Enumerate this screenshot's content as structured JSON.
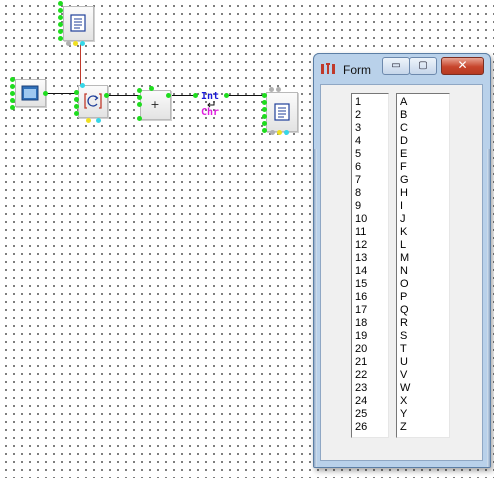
{
  "window": {
    "title": "Form",
    "minimize_label": "▭",
    "maximize_label": "▢",
    "close_label": "✕"
  },
  "nodes": {
    "add_label": "+",
    "convert_from": "Int",
    "convert_to": "Chr"
  },
  "list_numbers": [
    "1",
    "2",
    "3",
    "4",
    "5",
    "6",
    "7",
    "8",
    "9",
    "10",
    "11",
    "12",
    "13",
    "14",
    "15",
    "16",
    "17",
    "18",
    "19",
    "20",
    "21",
    "22",
    "23",
    "24",
    "25",
    "26"
  ],
  "list_letters": [
    "A",
    "B",
    "C",
    "D",
    "E",
    "F",
    "G",
    "H",
    "I",
    "J",
    "K",
    "L",
    "M",
    "N",
    "O",
    "P",
    "Q",
    "R",
    "S",
    "T",
    "U",
    "V",
    "W",
    "X",
    "Y",
    "Z"
  ],
  "colors": {
    "pin_green": "#1fdc1f",
    "wire_red": "#c0392b",
    "convert_int": "#1b1bd6",
    "convert_chr": "#e01ee0",
    "close_red": "#c7452c"
  }
}
